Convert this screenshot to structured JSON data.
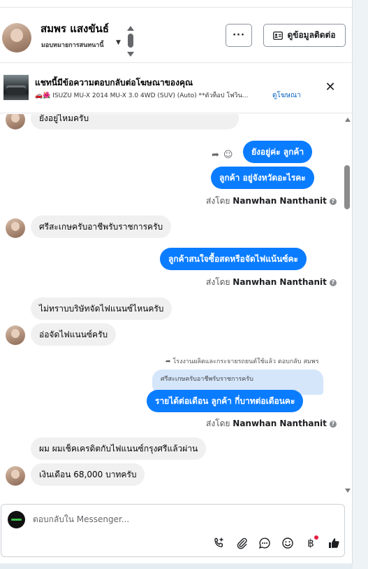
{
  "header": {
    "customer_name": "สมพร แสงขันธ์",
    "assign_label": "มอบหมายการสนทนานี้",
    "more_label": "···",
    "contact_info_label": "ดูข้อมูลติดต่อ"
  },
  "ad_banner": {
    "title": "แชทนี้มีข้อความตอบกลับต่อโฆษณาของคุณ",
    "description": "🚗🌺 ISUZU MU-X 2014 MU-X 3.0 4WD (SUV) (Auto) **ตัวท็อป โฟวิน...",
    "view_ad_label": "ดูโฆษณา",
    "close_label": "✕"
  },
  "messages": {
    "m1": "ยังอยู่ไหมครับ",
    "m2": "ยังอยู่ค่ะ  ลูกค้า",
    "m3": "ลูกค้า อยู่จังหวัดอะไรคะ",
    "m4": "ศรีสะเกษครับอาชีพรับราชการครับ",
    "m5": "ลูกค้าสนใจซื้อสดหรือจัดไฟแน้นซ์คะ",
    "m6": "ไม่ทราบบริษัทจัดไฟแนนซ์ไหนครับ",
    "m7": "อ่อจัดไฟแนนซ์ครับ",
    "reply_note": "โรงงานผลิตและกระจายรถยนต์ใช้แล้ว ตอบกลับ สมพร",
    "quoted": "ศรีสะเกษครับอาชีพรับราชการครับ",
    "m8": "รายได้ต่อเดือน  ลูกค้า กี่บาทต่อเดือนคะ",
    "m9": "ผม ผมเช็คเครดิตกับไฟแนนซ์กรุงศรีแล้วผ่าน",
    "m10": "เงินเดือน 68,000 บาทครับ"
  },
  "sent_by": {
    "prefix": "ส่งโดย",
    "agent": "Nanwhan Nanthanit",
    "info": "?"
  },
  "composer": {
    "placeholder": "ตอบกลับใน Messenger..."
  },
  "icons": [
    "chevron-down-icon",
    "contact-card-icon",
    "close-icon",
    "reply-icon",
    "emoji-icon",
    "info-icon",
    "add-call-icon",
    "attachment-icon",
    "chat-icon",
    "emoji-icon",
    "baht-icon",
    "thumbs-up-icon"
  ],
  "colors": {
    "accent": "#0a7cff",
    "link": "#0a66c2",
    "incoming_bubble": "#f0f0f0"
  }
}
